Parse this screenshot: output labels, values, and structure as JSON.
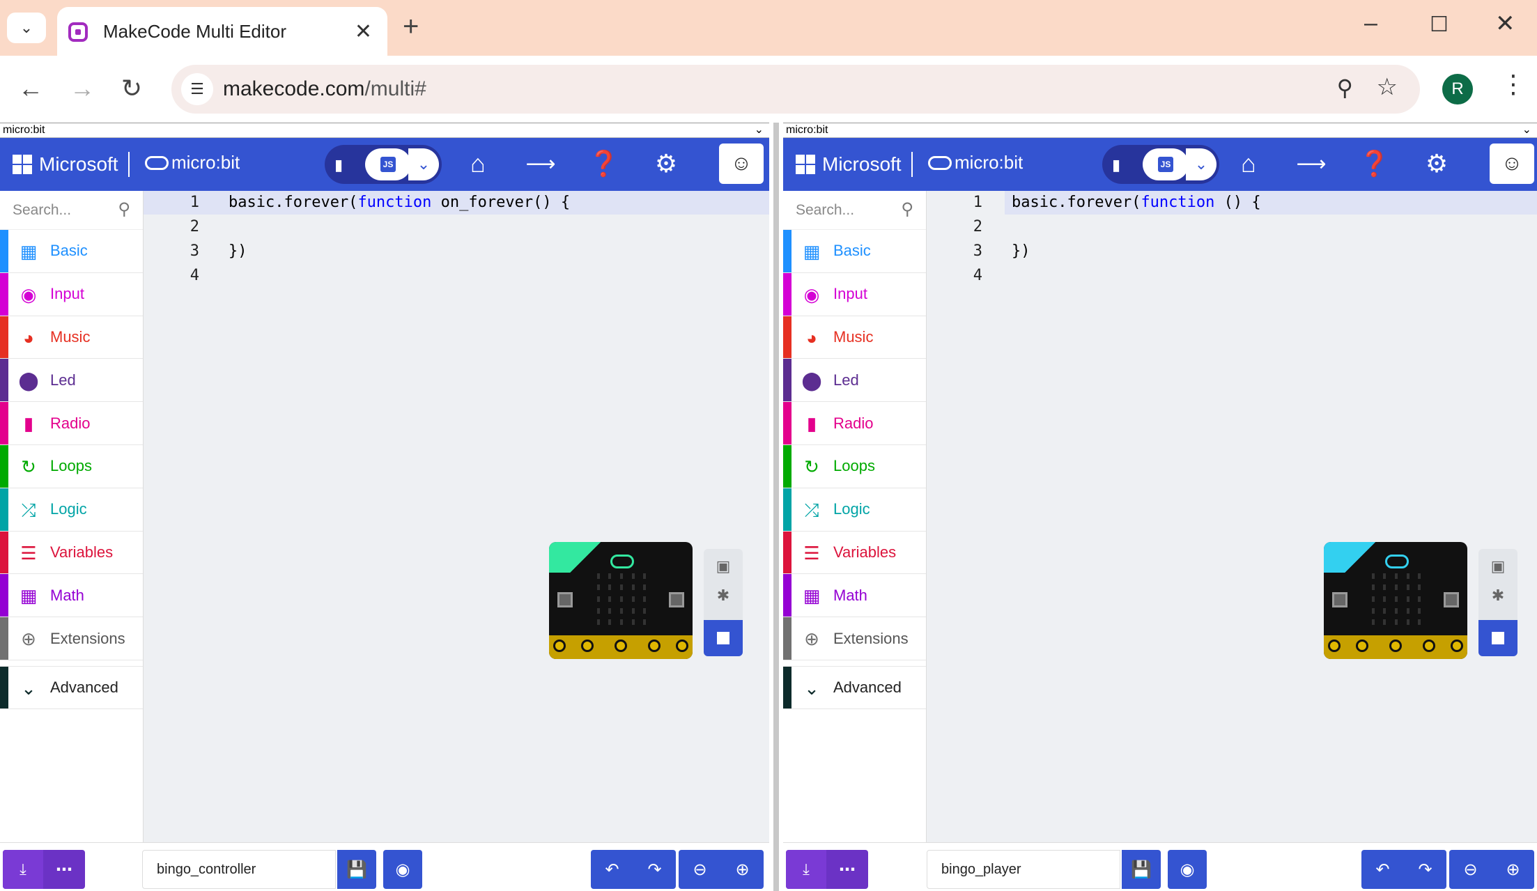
{
  "browser": {
    "tab_title": "MakeCode Multi Editor",
    "url_host": "makecode.com",
    "url_path": "/multi#",
    "avatar_letter": "R"
  },
  "left": {
    "target_select": "micro:bit",
    "brand": "Microsoft",
    "product": "micro:bit",
    "search_placeholder": "Search...",
    "categories": [
      {
        "label": "Basic",
        "color": "#1e90ff",
        "icon": "grid-icon"
      },
      {
        "label": "Input",
        "color": "#d400d4",
        "icon": "circle-icon"
      },
      {
        "label": "Music",
        "color": "#e63022",
        "icon": "headphones-icon"
      },
      {
        "label": "Led",
        "color": "#5c2d91",
        "icon": "toggle-icon"
      },
      {
        "label": "Radio",
        "color": "#e3008c",
        "icon": "signal-icon"
      },
      {
        "label": "Loops",
        "color": "#00aa00",
        "icon": "refresh-icon"
      },
      {
        "label": "Logic",
        "color": "#00a4a6",
        "icon": "shuffle-icon"
      },
      {
        "label": "Variables",
        "color": "#dc143c",
        "icon": "list-icon"
      },
      {
        "label": "Math",
        "color": "#9400d3",
        "icon": "calculator-icon"
      },
      {
        "label": "Extensions",
        "color": "#717171",
        "icon": "plus-circle-icon"
      }
    ],
    "advanced": "Advanced",
    "code_lines": [
      "1",
      "2",
      "3",
      "4"
    ],
    "code_line1_pre": "basic.forever(",
    "code_line1_kw": "function",
    "code_line1_post": " on_forever() {",
    "code_line3": "})",
    "project_name": "bingo_controller",
    "sim_accent": "#33e8a0"
  },
  "right": {
    "target_select": "micro:bit",
    "brand": "Microsoft",
    "product": "micro:bit",
    "search_placeholder": "Search...",
    "advanced": "Advanced",
    "code_lines": [
      "1",
      "2",
      "3",
      "4"
    ],
    "code_line1_pre": "basic.forever(",
    "code_line1_kw": "function",
    "code_line1_post": " () {",
    "code_line3": "})",
    "project_name": "bingo_player",
    "sim_accent": "#33d0f0"
  },
  "colors": {
    "header_blue": "#3454d1",
    "download_purple": "#6b32c5"
  }
}
